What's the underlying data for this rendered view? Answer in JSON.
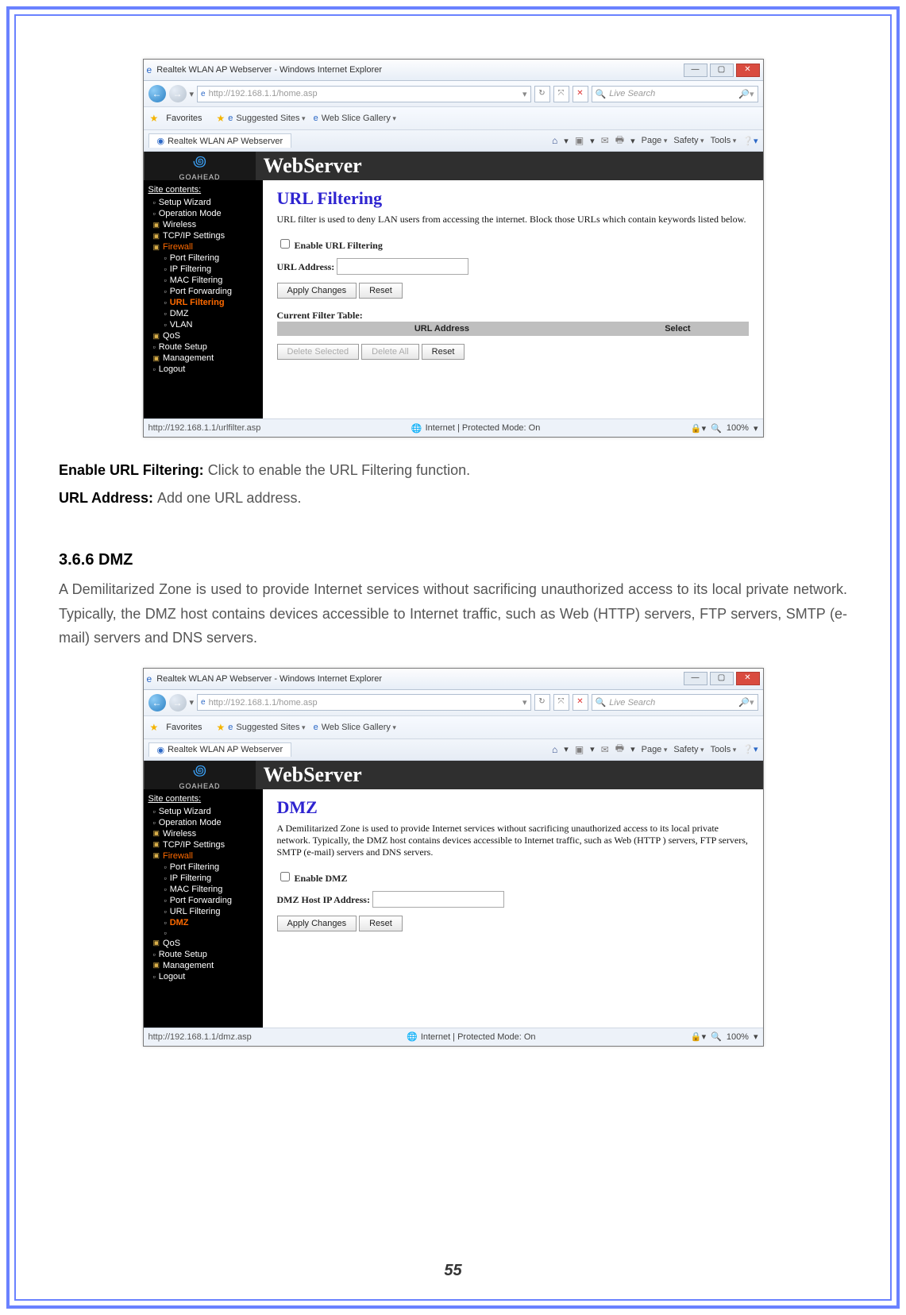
{
  "page_number": "55",
  "section_heading": "3.6.6 DMZ",
  "paragraph_after_shot1": [
    {
      "bold": "Enable URL Filtering: ",
      "text": "Click to enable the URL Filtering function."
    },
    {
      "bold": "URL Address: ",
      "text": "Add one URL address."
    }
  ],
  "dmz_paragraph": "A Demilitarized Zone is used to provide Internet services without sacrificing unauthorized access to its local private network. Typically, the DMZ host contains devices accessible to Internet traffic, such as Web (HTTP) servers, FTP servers, SMTP (e-mail) servers and DNS servers.",
  "ie_common": {
    "window_title": "Realtek WLAN AP Webserver - Windows Internet Explorer",
    "address": "http://192.168.1.1/home.asp",
    "search_placeholder": "Live Search",
    "fav_label": "Favorites",
    "suggested_sites": "Suggested Sites",
    "web_slice": "Web Slice Gallery",
    "tab_label": "Realtek WLAN AP Webserver",
    "menu_page": "Page",
    "menu_safety": "Safety",
    "menu_tools": "Tools",
    "zone": "Internet | Protected Mode: On",
    "zoom": "100%",
    "webserver_banner": "WebServer",
    "goahead": "GOAHEAD"
  },
  "side_tree": {
    "header": "Site contents:",
    "items": [
      "Setup Wizard",
      "Operation Mode",
      "Wireless",
      "TCP/IP Settings"
    ],
    "firewall_label": "Firewall",
    "firewall_children": [
      "Port Filtering",
      "IP Filtering",
      "MAC Filtering",
      "Port Forwarding",
      "URL Filtering",
      "DMZ",
      "VLAN"
    ],
    "tail": [
      "QoS",
      "Route Setup",
      "Management",
      "Logout"
    ]
  },
  "shot1": {
    "status_url": "http://192.168.1.1/urlfilter.asp",
    "content_title": "URL Filtering",
    "content_desc": "URL filter is used to deny LAN users from accessing the internet. Block those URLs which contain keywords listed below.",
    "enable_label": "Enable URL Filtering",
    "url_label": "URL Address:",
    "apply_btn": "Apply Changes",
    "reset_btn": "Reset",
    "filter_table_label": "Current Filter Table:",
    "th_url": "URL Address",
    "th_sel": "Select",
    "del_sel": "Delete Selected",
    "del_all": "Delete All"
  },
  "shot2": {
    "status_url": "http://192.168.1.1/dmz.asp",
    "content_title": "DMZ",
    "content_desc": "A Demilitarized Zone is used to provide Internet services without sacrificing unauthorized access to its local private network. Typically, the DMZ host contains devices accessible to Internet traffic, such as Web (HTTP ) servers, FTP servers, SMTP (e-mail) servers and DNS servers.",
    "enable_label": "Enable DMZ",
    "host_label": "DMZ Host IP Address:",
    "apply_btn": "Apply Changes",
    "reset_btn": "Reset"
  }
}
